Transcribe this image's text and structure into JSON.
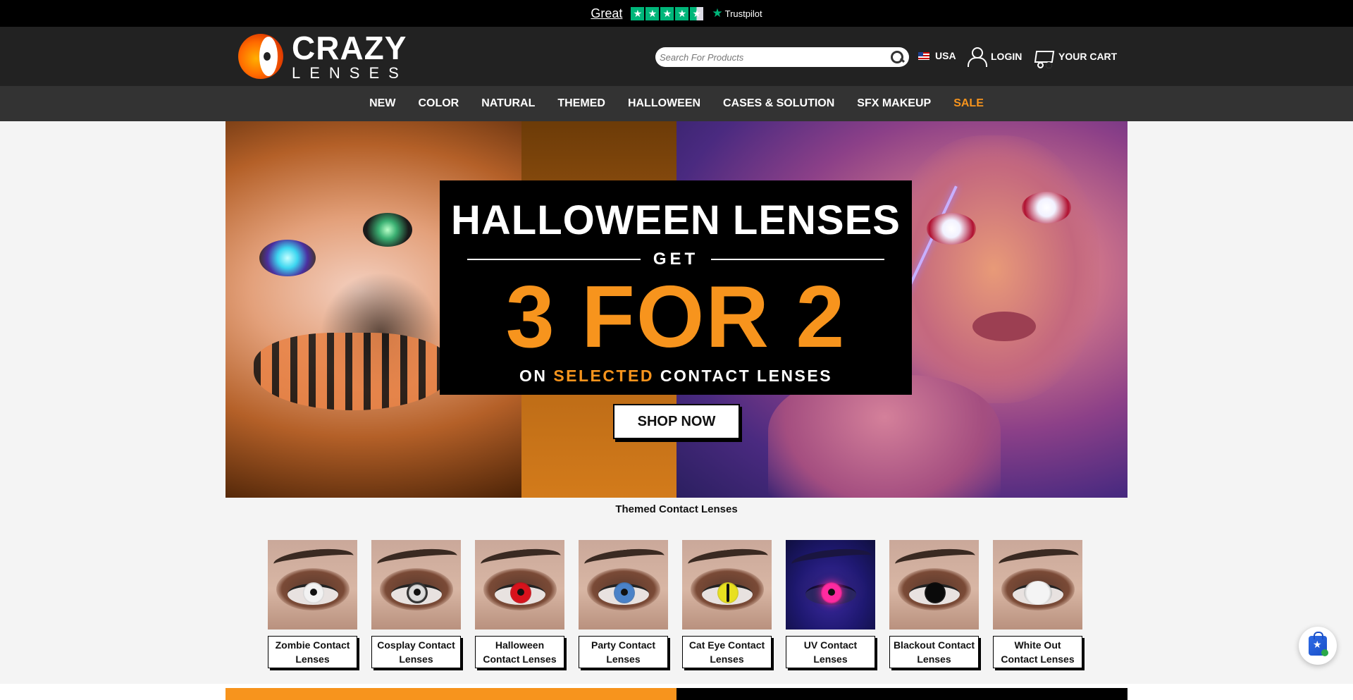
{
  "trustbar": {
    "rating_word": "Great",
    "stars": 4.5,
    "brand": "Trustpilot"
  },
  "header": {
    "logo": {
      "top": "CRAZY",
      "bottom": "LENSES"
    },
    "search": {
      "placeholder": "Search For Products",
      "value": ""
    },
    "country": "USA",
    "login_label": "LOGIN",
    "cart_label": "YOUR CART"
  },
  "nav": {
    "items": [
      "NEW",
      "COLOR",
      "NATURAL",
      "THEMED",
      "HALLOWEEN",
      "CASES & SOLUTION",
      "SFX MAKEUP",
      "SALE"
    ]
  },
  "hero": {
    "title": "HALLOWEEN LENSES",
    "get": "GET",
    "offer": "3 FOR 2",
    "sub_prefix": "ON",
    "sub_highlight": "SELECTED",
    "sub_suffix": "CONTACT LENSES",
    "button_label": "SHOP NOW"
  },
  "themed": {
    "title": "Themed Contact Lenses",
    "tiles": [
      {
        "label": "Zombie Contact Lenses",
        "iris": "#f2f2f2"
      },
      {
        "label": "Cosplay Contact Lenses",
        "iris": "#dcdcdc"
      },
      {
        "label": "Halloween Contact Lenses",
        "iris": "#d8121c"
      },
      {
        "label": "Party Contact Lenses",
        "iris": "#4a82c8"
      },
      {
        "label": "Cat Eye Contact Lenses",
        "iris": "#e8e020"
      },
      {
        "label": "UV Contact Lenses",
        "iris": "#ff2aa0"
      },
      {
        "label": "Blackout Contact Lenses",
        "iris": "#0a0a0a"
      },
      {
        "label": "White Out Contact Lenses",
        "iris": "#f4f4f4"
      }
    ]
  },
  "colors": {
    "accent": "#f7941d",
    "trustpilot_green": "#00b67a",
    "header_bg": "#222222",
    "nav_bg": "#333333"
  }
}
